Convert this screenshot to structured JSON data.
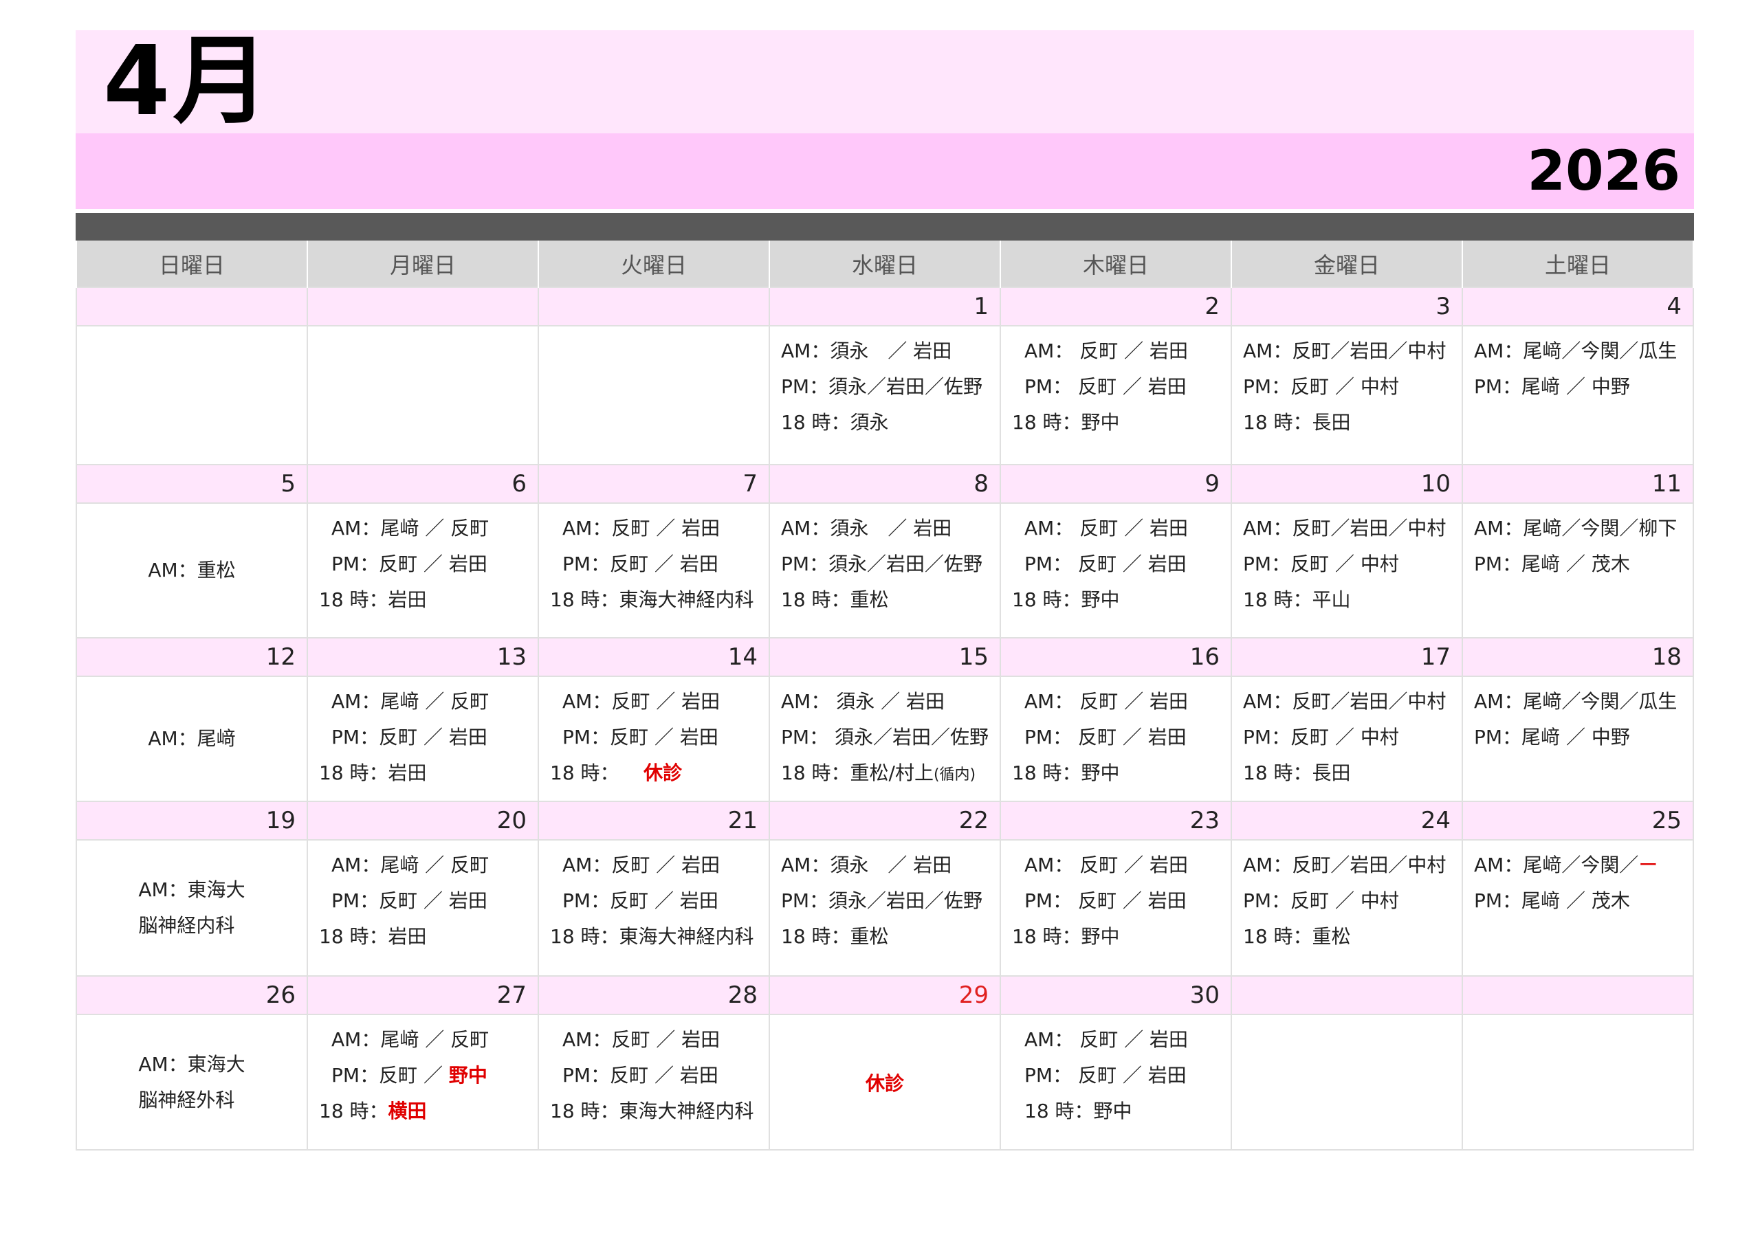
{
  "header": {
    "month": "4月",
    "year": "2026"
  },
  "weekdays": [
    "日曜日",
    "月曜日",
    "火曜日",
    "水曜日",
    "木曜日",
    "金曜日",
    "土曜日"
  ],
  "colors": {
    "title_band": "#ffe6fc",
    "year_band": "#ffc8fa",
    "dark_bar": "#595959",
    "weekday_header": "#d9d9d9",
    "date_row": "#ffe6fc",
    "holiday_red": "#e00000"
  },
  "week1": {
    "dates": [
      "",
      "",
      "",
      "1",
      "2",
      "3",
      "4"
    ],
    "wed": {
      "l1": "AM：須永　／ 岩田",
      "l2": "PM：須永／岩田／佐野",
      "l3": "18 時：須永"
    },
    "thu": {
      "l1": "AM： 反町 ／ 岩田",
      "l2": "PM： 反町 ／ 岩田",
      "l3": "18 時：野中"
    },
    "fri": {
      "l1": "AM：反町／岩田／中村",
      "l2": "PM：反町 ／ 中村",
      "l3": "18 時：長田"
    },
    "sat": {
      "l1": "AM：尾﨑／今関／瓜生",
      "l2": "PM：尾﨑 ／ 中野"
    }
  },
  "week2": {
    "dates": [
      "5",
      "6",
      "7",
      "8",
      "9",
      "10",
      "11"
    ],
    "sun": {
      "l1": "AM：重松"
    },
    "mon": {
      "l1": "AM：尾﨑 ／ 反町",
      "l2": "PM：反町 ／ 岩田",
      "l3": "18 時：岩田"
    },
    "tue": {
      "l1": "AM：反町 ／ 岩田",
      "l2": "PM：反町 ／ 岩田",
      "l3": "18 時：東海大神経内科"
    },
    "wed": {
      "l1": "AM：須永　／ 岩田",
      "l2": "PM：須永／岩田／佐野",
      "l3": "18 時：重松"
    },
    "thu": {
      "l1": "AM： 反町 ／ 岩田",
      "l2": "PM： 反町 ／ 岩田",
      "l3": "18 時：野中"
    },
    "fri": {
      "l1": "AM：反町／岩田／中村",
      "l2": "PM：反町 ／ 中村",
      "l3": "18 時：平山"
    },
    "sat": {
      "l1": "AM：尾﨑／今関／柳下",
      "l2": "PM：尾﨑 ／ 茂木"
    }
  },
  "week3": {
    "dates": [
      "12",
      "13",
      "14",
      "15",
      "16",
      "17",
      "18"
    ],
    "sun": {
      "l1": "AM：尾﨑"
    },
    "mon": {
      "l1": "AM：尾﨑 ／ 反町",
      "l2": "PM：反町 ／ 岩田",
      "l3": "18 時：岩田"
    },
    "tue": {
      "l1": "AM：反町 ／ 岩田",
      "l2": "PM：反町 ／ 岩田",
      "l3a": "18 時：",
      "l3b": "休診"
    },
    "wed": {
      "l1": "AM： 須永 ／ 岩田",
      "l2": "PM： 須永／岩田／佐野",
      "l3a": "18 時：重松/村上",
      "l3b": "(循内)"
    },
    "thu": {
      "l1": "AM： 反町 ／ 岩田",
      "l2": "PM： 反町 ／ 岩田",
      "l3": "18 時：野中"
    },
    "fri": {
      "l1": "AM：反町／岩田／中村",
      "l2": "PM：反町 ／ 中村",
      "l3": "18 時：長田"
    },
    "sat": {
      "l1": "AM：尾﨑／今関／瓜生",
      "l2": "PM：尾﨑 ／ 中野"
    }
  },
  "week4": {
    "dates": [
      "19",
      "20",
      "21",
      "22",
      "23",
      "24",
      "25"
    ],
    "sun": {
      "l1": "AM：東海大",
      "l2": "脳神経内科"
    },
    "mon": {
      "l1": "AM：尾﨑 ／ 反町",
      "l2": "PM：反町 ／ 岩田",
      "l3": "18 時：岩田"
    },
    "tue": {
      "l1": "AM：反町 ／ 岩田",
      "l2": "PM：反町 ／ 岩田",
      "l3": "18 時：東海大神経内科"
    },
    "wed": {
      "l1": "AM：須永　／ 岩田",
      "l2": "PM：須永／岩田／佐野",
      "l3": "18 時：重松"
    },
    "thu": {
      "l1": "AM： 反町 ／ 岩田",
      "l2": "PM： 反町 ／ 岩田",
      "l3": "18 時：野中"
    },
    "fri": {
      "l1": "AM：反町／岩田／中村",
      "l2": "PM：反町 ／ 中村",
      "l3": "18 時：重松"
    },
    "sat": {
      "l1a": "AM：尾﨑／今関／",
      "l1b": "ー",
      "l2": "PM：尾﨑 ／ 茂木"
    }
  },
  "week5": {
    "dates": [
      "26",
      "27",
      "28",
      "29",
      "30",
      "",
      ""
    ],
    "sun": {
      "l1": "AM：東海大",
      "l2": "脳神経外科"
    },
    "mon": {
      "l1": "AM：尾﨑 ／ 反町",
      "l2a": "PM：反町 ／ ",
      "l2b": "野中",
      "l3a": "18 時：",
      "l3b": "横田"
    },
    "tue": {
      "l1": "AM：反町 ／ 岩田",
      "l2": "PM：反町 ／ 岩田",
      "l3": "18 時：東海大神経内科"
    },
    "wed": {
      "l1": "休診"
    },
    "thu": {
      "l1": "AM： 反町 ／ 岩田",
      "l2": "PM： 反町 ／ 岩田",
      "l3": "18 時：野中"
    }
  }
}
